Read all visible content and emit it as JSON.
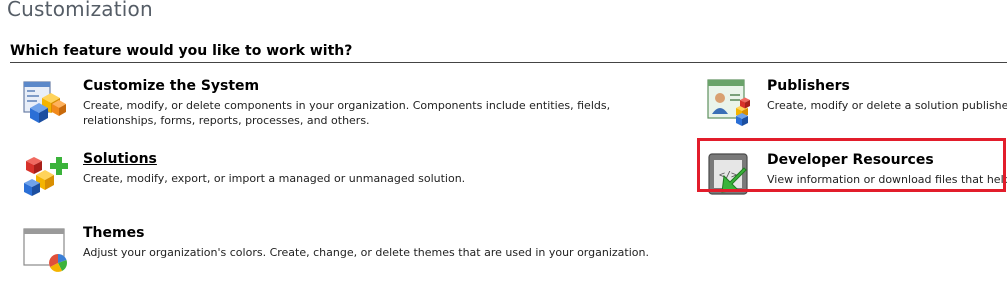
{
  "page": {
    "title": "Customization"
  },
  "section": {
    "heading": "Which feature would you like to work with?"
  },
  "features": {
    "customize": {
      "title": "Customize the System",
      "description": "Create, modify, or delete components in your organization. Components include entities, fields, relationships, forms, reports, processes, and others.",
      "icon": "customize-system-icon"
    },
    "solutions": {
      "title": "Solutions",
      "description": "Create, modify, export, or import a managed or unmanaged solution.",
      "icon": "solutions-icon"
    },
    "themes": {
      "title": "Themes",
      "description": "Adjust your organization's colors. Create, change, or delete themes that are used in your organization.",
      "icon": "themes-icon"
    },
    "publishers": {
      "title": "Publishers",
      "description": "Create, modify or delete a solution publisher.",
      "icon": "publishers-icon"
    },
    "developer_resources": {
      "title": "Developer Resources",
      "description": "View information or download files that help you",
      "icon": "developer-resources-icon"
    }
  },
  "colors": {
    "highlight": "#e21d2b",
    "title_gray": "#555d66",
    "cube_blue": "#2b6fd6",
    "cube_orange": "#f28a1c",
    "cube_yellow": "#f4c400",
    "cube_red": "#d8322a",
    "plus_green": "#3bb33b"
  }
}
